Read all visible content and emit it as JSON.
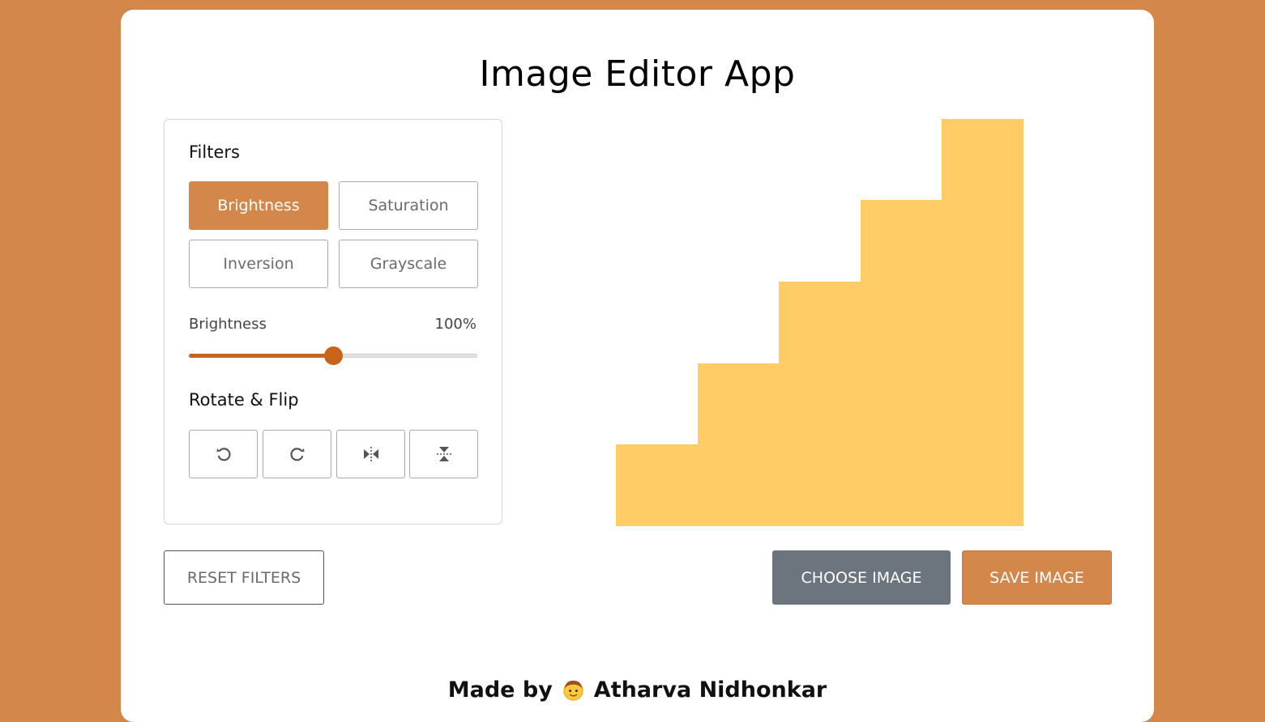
{
  "app": {
    "title": "Image Editor App"
  },
  "filters": {
    "heading": "Filters",
    "buttons": [
      {
        "label": "Brightness",
        "active": true
      },
      {
        "label": "Saturation",
        "active": false
      },
      {
        "label": "Inversion",
        "active": false
      },
      {
        "label": "Grayscale",
        "active": false
      }
    ],
    "slider": {
      "name": "Brightness",
      "value_text": "100%",
      "value": 100,
      "max": 200
    }
  },
  "rotate_flip": {
    "heading": "Rotate & Flip",
    "buttons": [
      {
        "icon": "rotate-left-icon"
      },
      {
        "icon": "rotate-right-icon"
      },
      {
        "icon": "flip-horizontal-icon"
      },
      {
        "icon": "flip-vertical-icon"
      }
    ]
  },
  "actions": {
    "reset_label": "Reset Filters",
    "choose_label": "Choose Image",
    "save_label": "Save Image"
  },
  "footer": {
    "prefix": "Made by",
    "author": "Atharva Nidhonkar",
    "icon": "man-face-emoji"
  },
  "colors": {
    "accent": "#d4874a",
    "slider": "#c8641a",
    "secondary": "#6c757d",
    "preview_fill": "#ffcc66"
  }
}
